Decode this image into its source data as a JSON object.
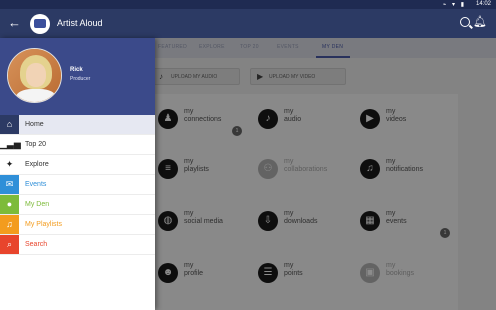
{
  "status_bar": {
    "time": "14:02",
    "icons": "⌁ ▾ ▮"
  },
  "app_bar": {
    "title": "Artist Aloud",
    "back_icon": "arrow-left-icon",
    "search_icon": "search-icon",
    "bell_icon": "bell-icon"
  },
  "tabs": [
    "FEATURED",
    "EXPLORE",
    "TOP 20",
    "EVENTS",
    "MY DEN"
  ],
  "active_tab": "MY DEN",
  "uploads": {
    "audio_label": "UPLOAD MY AUDIO",
    "video_label": "UPLOAD MY VIDEO"
  },
  "tiles": [
    {
      "line1": "my",
      "line2": "connections",
      "icon": "♟",
      "enabled": true
    },
    {
      "line1": "my",
      "line2": "audio",
      "icon": "♪",
      "enabled": true
    },
    {
      "line1": "my",
      "line2": "videos",
      "icon": "▶",
      "enabled": true
    },
    {
      "line1": "my",
      "line2": "playlists",
      "icon": "≡",
      "enabled": true
    },
    {
      "line1": "my",
      "line2": "collaborations",
      "icon": "⚇",
      "enabled": false
    },
    {
      "line1": "my",
      "line2": "notifications",
      "icon": "♫",
      "enabled": true
    },
    {
      "line1": "my",
      "line2": "social media",
      "icon": "◍",
      "enabled": true
    },
    {
      "line1": "my",
      "line2": "downloads",
      "icon": "⇩",
      "enabled": true
    },
    {
      "line1": "my",
      "line2": "events",
      "icon": "▦",
      "enabled": true
    },
    {
      "line1": "my",
      "line2": "profile",
      "icon": "☻",
      "enabled": true
    },
    {
      "line1": "my",
      "line2": "points",
      "icon": "☰",
      "enabled": true
    },
    {
      "line1": "my",
      "line2": "bookings",
      "icon": "▣",
      "enabled": false
    }
  ],
  "badges": [
    "1",
    "1"
  ],
  "drawer": {
    "user_name": "Rick",
    "user_role": "Producer",
    "items": [
      {
        "label": "Home",
        "icon": "home-icon",
        "glyph": "⌂",
        "color": "#2c3a64",
        "text_color": "#333333"
      },
      {
        "label": "Top 20",
        "icon": "chart-icon",
        "glyph": "▁▃▅",
        "color": "#ffffff",
        "text_color": "#333333"
      },
      {
        "label": "Explore",
        "icon": "explore-icon",
        "glyph": "✦",
        "color": "#ffffff",
        "text_color": "#333333"
      },
      {
        "label": "Events",
        "icon": "events-icon",
        "glyph": "✉",
        "color": "#2f8fd8",
        "text_color": "#2f8fd8"
      },
      {
        "label": "My Den",
        "icon": "avatar-icon",
        "glyph": "●",
        "color": "#7dbb3a",
        "text_color": "#7dbb3a"
      },
      {
        "label": "My Playlists",
        "icon": "playlist-icon",
        "glyph": "♫",
        "color": "#f39c1e",
        "text_color": "#f39c1e"
      },
      {
        "label": "Search",
        "icon": "search-icon",
        "glyph": "⌕",
        "color": "#e8452c",
        "text_color": "#e8452c"
      }
    ]
  }
}
